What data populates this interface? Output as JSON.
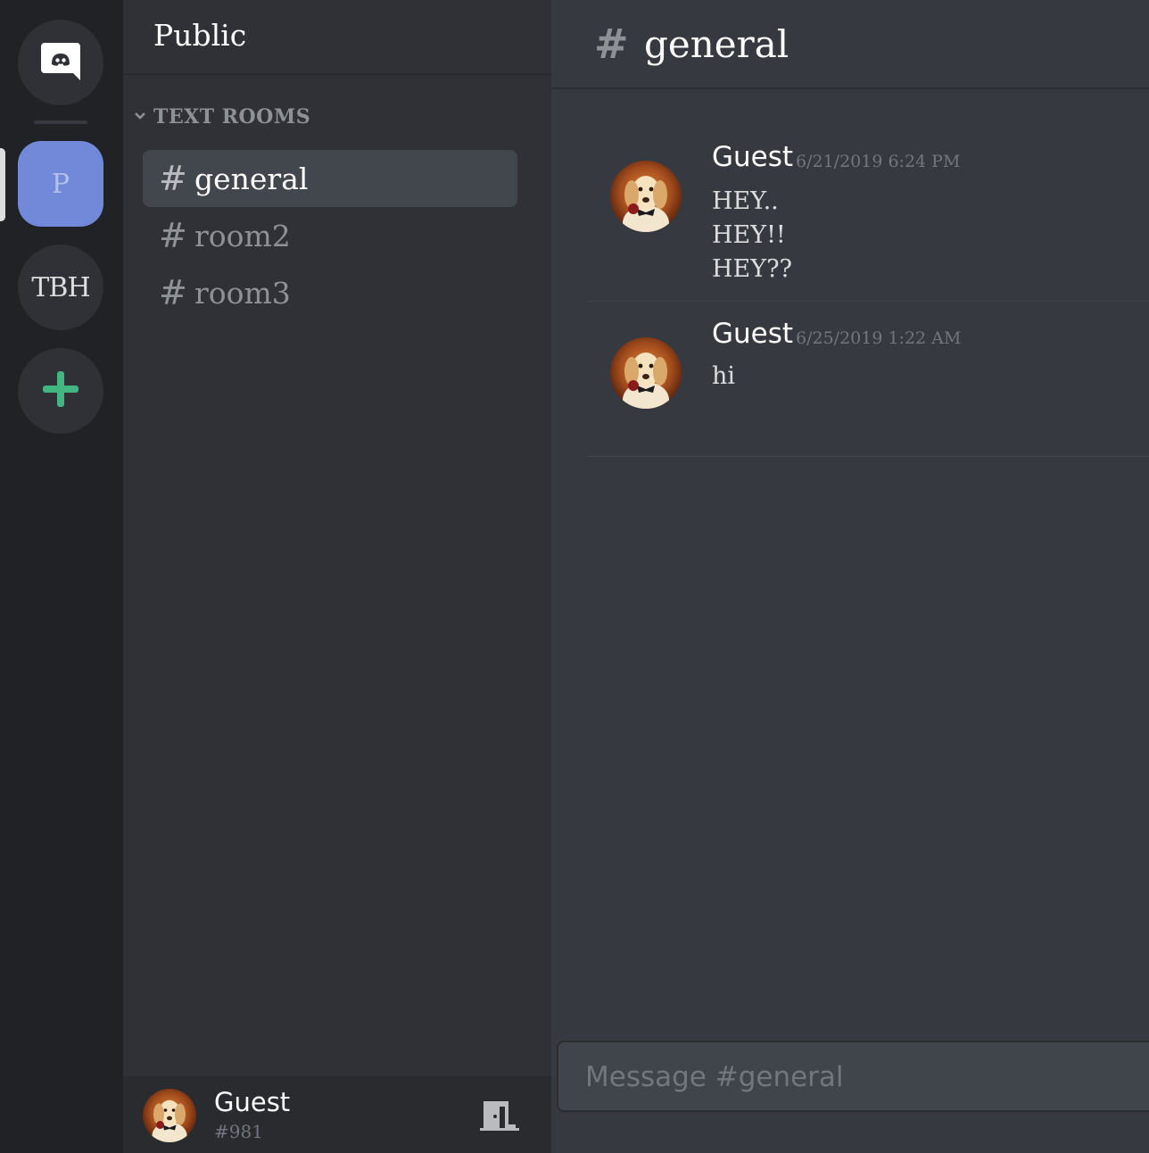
{
  "rail": {
    "home_icon": "discord-logo-icon",
    "servers": [
      {
        "label": "P",
        "active": true,
        "color": "#7289da"
      },
      {
        "label": "TBH",
        "active": false
      }
    ],
    "add_icon": "plus-icon",
    "add_color": "#43b581"
  },
  "sidebar": {
    "server_name": "Public",
    "category": "TEXT ROOMS",
    "channels": [
      {
        "hash": "#",
        "name": "general",
        "active": true
      },
      {
        "hash": "#",
        "name": "room2",
        "active": false
      },
      {
        "hash": "#",
        "name": "room3",
        "active": false
      }
    ]
  },
  "user": {
    "name": "Guest",
    "tag": "#981",
    "leave_icon": "door-exit-icon"
  },
  "main": {
    "hash": "#",
    "channel_title": "general",
    "messages": [
      {
        "author": "Guest",
        "timestamp": "6/21/2019 6:24 PM",
        "lines": [
          "HEY..",
          "HEY!!",
          "HEY??"
        ]
      },
      {
        "author": "Guest",
        "timestamp": "6/25/2019 1:22 AM",
        "lines": [
          "hi"
        ]
      }
    ],
    "composer_placeholder": "Message #general"
  }
}
